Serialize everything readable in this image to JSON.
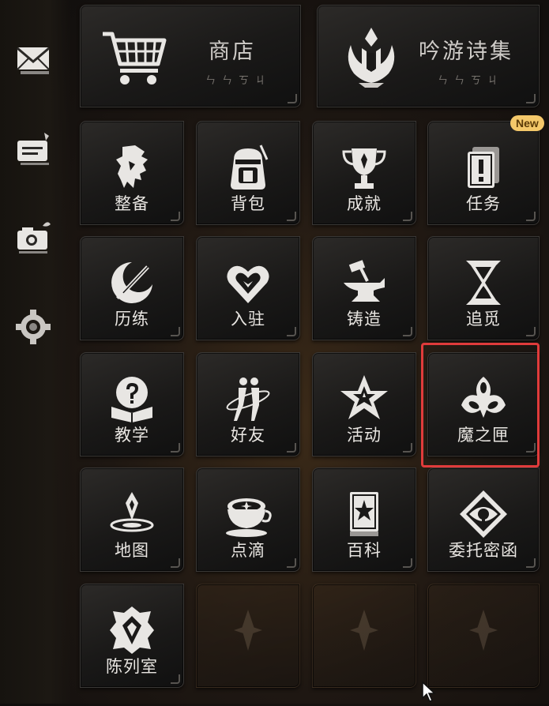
{
  "top_buttons": [
    {
      "id": "shop",
      "title": "商店",
      "sub": "ㄣㄣㄎㄐ"
    },
    {
      "id": "poetry",
      "title": "吟游诗集",
      "sub": "ㄣㄣㄎㄐ"
    }
  ],
  "grid": [
    {
      "label": "整备",
      "icon": "character-profile-icon"
    },
    {
      "label": "背包",
      "icon": "backpack-icon"
    },
    {
      "label": "成就",
      "icon": "trophy-icon"
    },
    {
      "label": "任务",
      "icon": "quest-card-icon",
      "badge": "New"
    },
    {
      "label": "历练",
      "icon": "sword-crescent-icon"
    },
    {
      "label": "入驻",
      "icon": "heart-link-icon"
    },
    {
      "label": "铸造",
      "icon": "anvil-hammer-icon"
    },
    {
      "label": "追觅",
      "icon": "hourglass-icon"
    },
    {
      "label": "教学",
      "icon": "question-book-icon"
    },
    {
      "label": "好友",
      "icon": "friends-icon"
    },
    {
      "label": "活动",
      "icon": "star-emblem-icon"
    },
    {
      "label": "魔之匣",
      "icon": "trefoil-box-icon"
    },
    {
      "label": "地图",
      "icon": "map-pin-icon"
    },
    {
      "label": "点滴",
      "icon": "teacup-star-icon"
    },
    {
      "label": "百科",
      "icon": "encyclopedia-icon"
    },
    {
      "label": "委托密函",
      "icon": "eye-letter-icon"
    },
    {
      "label": "陈列室",
      "icon": "gallery-crest-icon"
    }
  ],
  "sidebar": [
    "mail-icon",
    "message-card-icon",
    "camera-icon",
    "settings-gear-icon"
  ],
  "highlight_target": "魔之匣",
  "colors": {
    "highlight": "#e03b3b",
    "badge": "#f4c86a",
    "label": "#e9e6e2"
  }
}
